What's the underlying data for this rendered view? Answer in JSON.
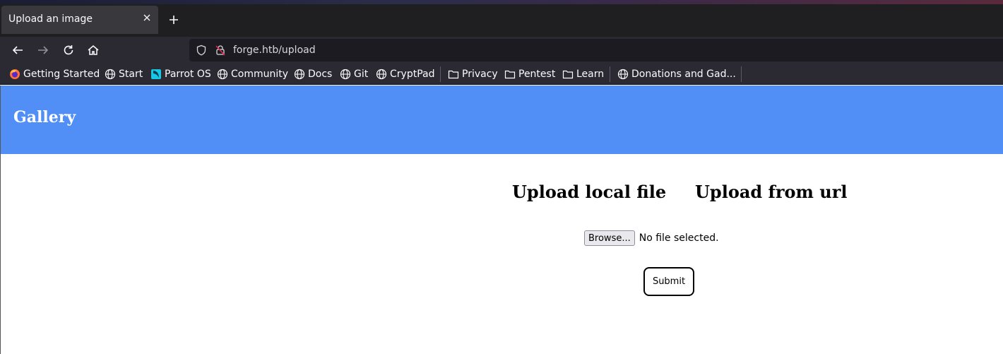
{
  "browser": {
    "tab": {
      "title": "Upload an image"
    },
    "url": "forge.htb/upload",
    "bookmarks": [
      {
        "label": "Getting Started",
        "icon": "firefox-icon"
      },
      {
        "label": "Start",
        "icon": "globe-icon"
      },
      {
        "label": "Parrot OS",
        "icon": "parrot-icon"
      },
      {
        "label": "Community",
        "icon": "globe-icon"
      },
      {
        "label": "Docs",
        "icon": "globe-icon"
      },
      {
        "label": "Git",
        "icon": "globe-icon"
      },
      {
        "label": "CryptPad",
        "icon": "globe-icon"
      },
      {
        "label": "Privacy",
        "icon": "folder-icon"
      },
      {
        "label": "Pentest",
        "icon": "folder-icon"
      },
      {
        "label": "Learn",
        "icon": "folder-icon"
      },
      {
        "label": "Donations and Gad...",
        "icon": "globe-icon"
      }
    ]
  },
  "page": {
    "brand": "Gallery",
    "tabs": [
      "Upload local file",
      "Upload from url"
    ],
    "file_input": {
      "button_label": "Browse...",
      "status": "No file selected."
    },
    "submit_label": "Submit"
  },
  "colors": {
    "header_bg": "#518ff7",
    "chrome_bg": "#2b2a33",
    "tabbar_bg": "#1f1f21"
  }
}
